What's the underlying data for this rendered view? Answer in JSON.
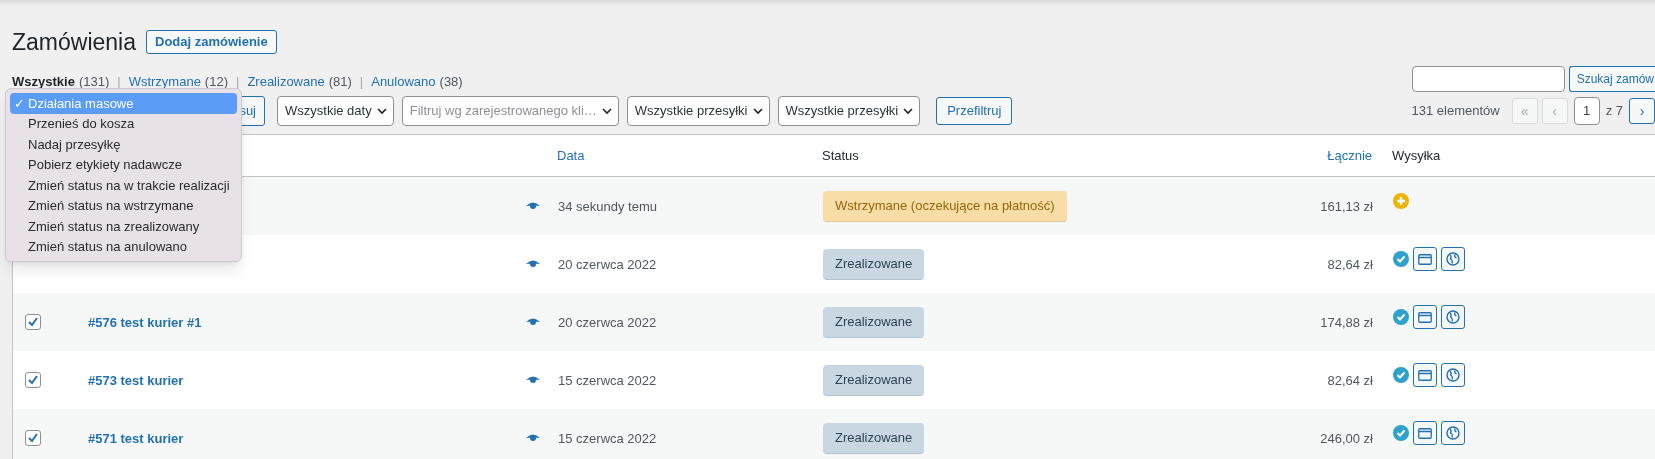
{
  "title": "Zamówienia",
  "add_button": "Dodaj zamówienie",
  "views": [
    {
      "label": "Wszystkie",
      "count": "(131)",
      "selected": true
    },
    {
      "label": "Wstrzymane",
      "count": "(12)",
      "selected": false
    },
    {
      "label": "Zrealizowane",
      "count": "(81)",
      "selected": false
    },
    {
      "label": "Anulowano",
      "count": "(38)",
      "selected": false
    }
  ],
  "separator": "|",
  "search_button": "Szukaj zamów",
  "apply_button": "suj",
  "filters": [
    {
      "value": "Wszystkie daty"
    },
    {
      "placeholder": "Filtruj wg zarejestrowanego kli…"
    },
    {
      "value": "Wszystkie przesyłki"
    },
    {
      "value": "Wszystkie przesyłki"
    }
  ],
  "filter_button": "Przefiltruj",
  "pagination": {
    "count": "131 elementów",
    "first": "«",
    "prev": "‹",
    "page": "1",
    "of": "z 7",
    "next": "›",
    "first_disabled": true,
    "prev_disabled": true
  },
  "bulk_menu": [
    {
      "label": "Działania masowe",
      "selected": true,
      "mark": "✓"
    },
    {
      "label": "Przenieś do kosza",
      "selected": false
    },
    {
      "label": "Nadaj przesyłkę",
      "selected": false
    },
    {
      "label": "Pobierz etykiety nadawcze",
      "selected": false
    },
    {
      "label": "Zmień status na w trakcie realizacji",
      "selected": false
    },
    {
      "label": "Zmień status na wstrzymane",
      "selected": false
    },
    {
      "label": "Zmień status na zrealizowany",
      "selected": false
    },
    {
      "label": "Zmień status na anulowano",
      "selected": false
    }
  ],
  "table": {
    "columns": [
      {
        "label": "Data",
        "sortable": true
      },
      {
        "label": "Status",
        "sortable": false
      },
      {
        "label": "Łącznie",
        "sortable": true
      },
      {
        "label": "Wysyłka",
        "sortable": false
      }
    ],
    "rows": [
      {
        "date": "34 sekundy temu",
        "status": {
          "label": "Wstrzymane (oczekujące na płatność)",
          "kind": "on-hold"
        },
        "total": "161,13 zł",
        "shipping": {
          "kind": "add"
        }
      },
      {
        "date": "20 czerwca 2022",
        "status": {
          "label": "Zrealizowane",
          "kind": "completed"
        },
        "total": "82,64 zł",
        "shipping": {
          "kind": "sent"
        }
      },
      {
        "checked": true,
        "order": "#576 test kurier #1",
        "date": "20 czerwca 2022",
        "status": {
          "label": "Zrealizowane",
          "kind": "completed"
        },
        "total": "174,88 zł",
        "shipping": {
          "kind": "sent"
        }
      },
      {
        "checked": true,
        "order": "#573 test kurier",
        "date": "15 czerwca 2022",
        "status": {
          "label": "Zrealizowane",
          "kind": "completed"
        },
        "total": "82,64 zł",
        "shipping": {
          "kind": "sent"
        }
      },
      {
        "checked": true,
        "order": "#571 test kurier",
        "date": "15 czerwca 2022",
        "status": {
          "label": "Zrealizowane",
          "kind": "completed"
        },
        "total": "246,00 zł",
        "shipping": {
          "kind": "sent"
        }
      }
    ]
  }
}
